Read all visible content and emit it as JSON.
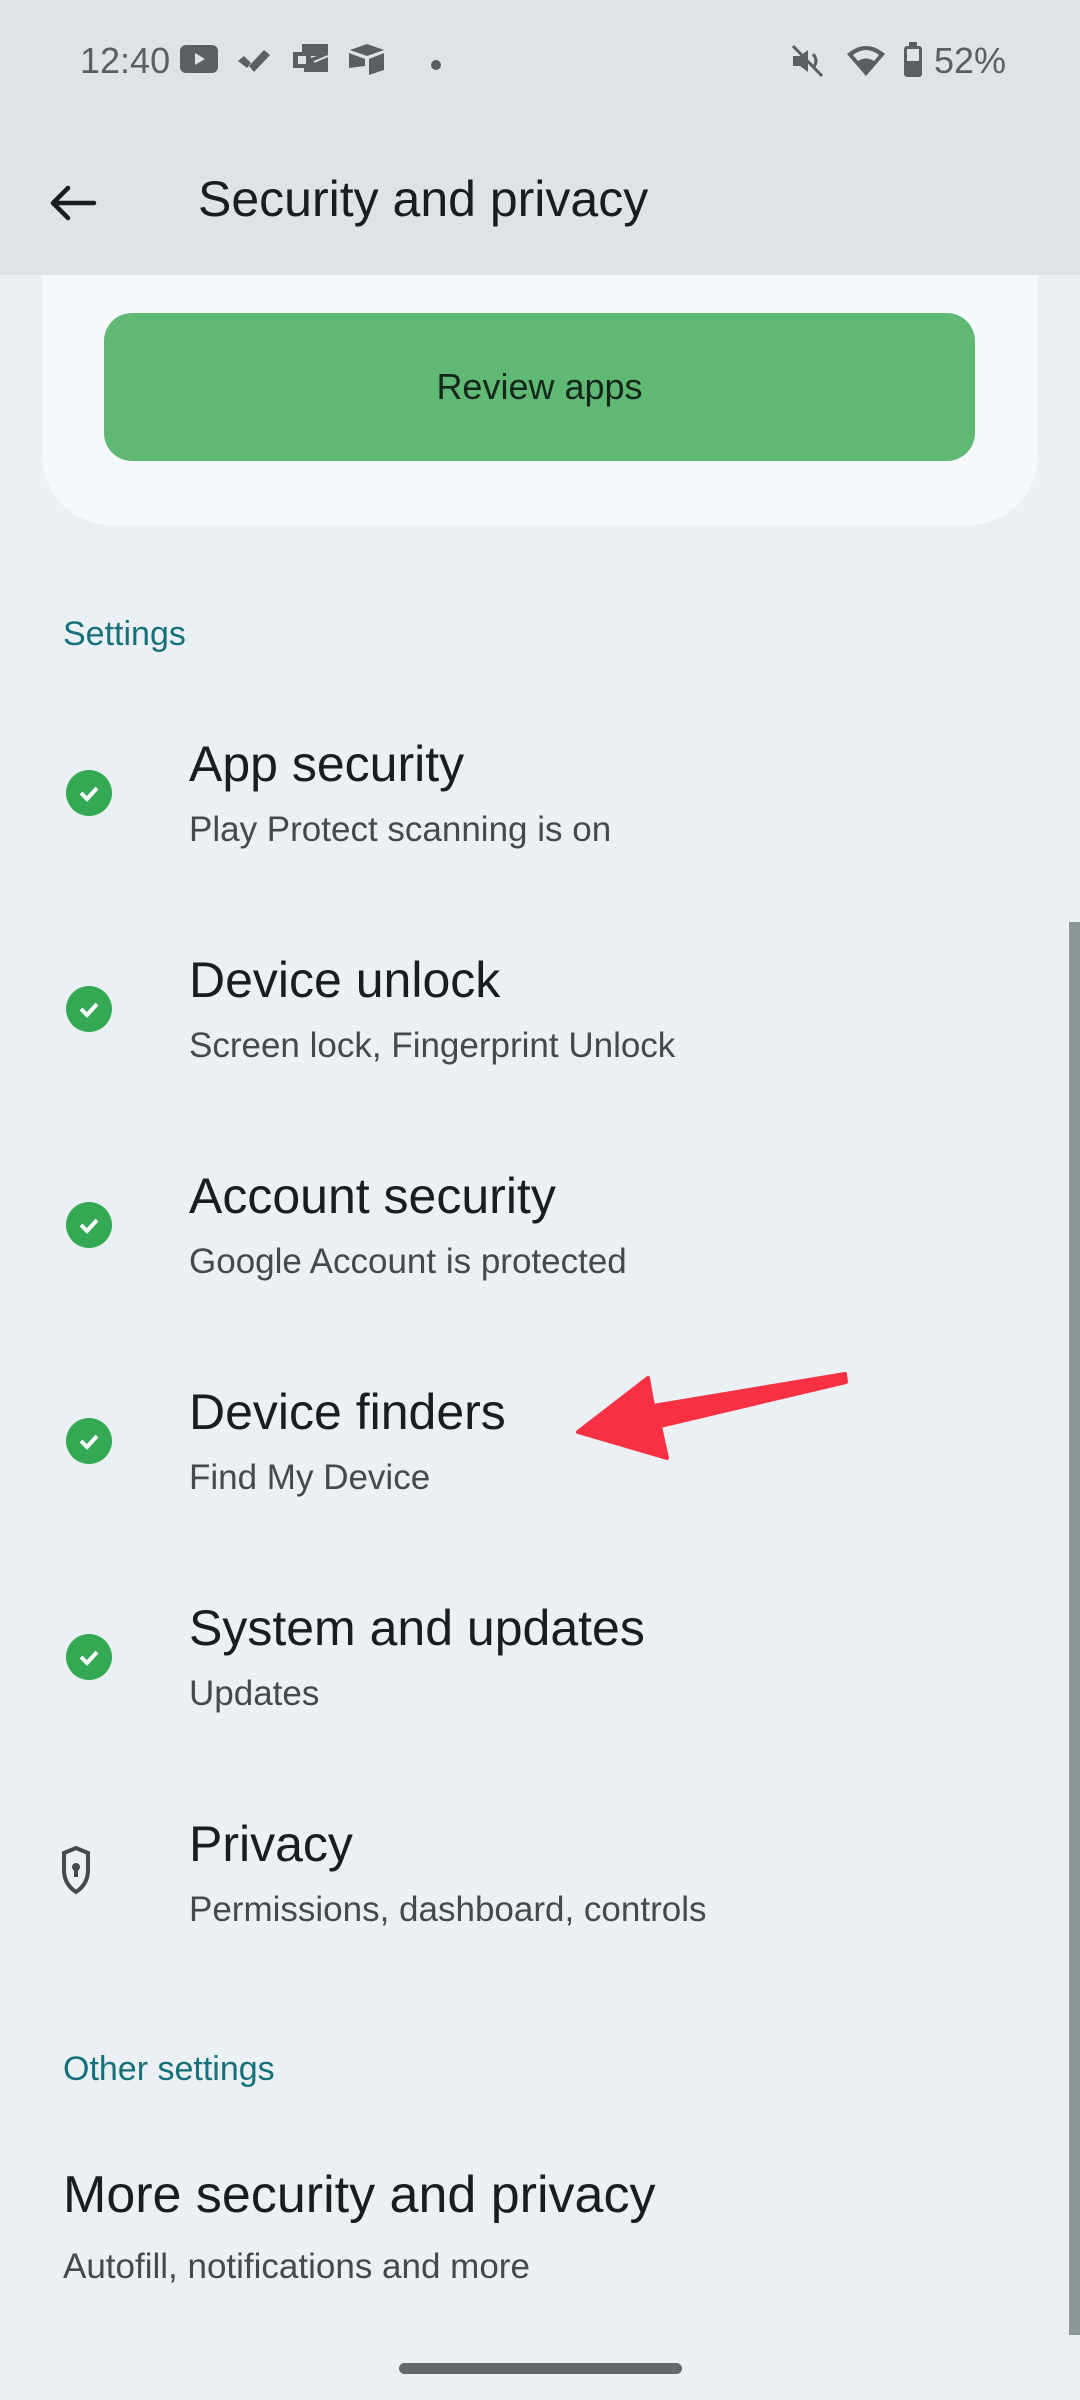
{
  "status_bar": {
    "time": "12:40",
    "notification_icons": [
      "youtube-icon",
      "tasks-check-icon",
      "outlook-icon",
      "box-icon",
      "more-dot-icon"
    ],
    "system_icons": [
      "vibrate-off-icon",
      "wifi-icon",
      "battery-icon"
    ],
    "battery_percent": "52%"
  },
  "app_bar": {
    "back_icon": "arrow-left-icon",
    "title": "Security and privacy"
  },
  "review_card": {
    "button_label": "Review apps",
    "button_color": "#5fb975"
  },
  "sections": {
    "settings_label": "Settings",
    "other_label": "Other settings"
  },
  "items": [
    {
      "title": "App security",
      "subtitle": "Play Protect scanning is on",
      "icon": "check-circle-icon"
    },
    {
      "title": "Device unlock",
      "subtitle": "Screen lock, Fingerprint Unlock",
      "icon": "check-circle-icon"
    },
    {
      "title": "Account security",
      "subtitle": "Google Account is protected",
      "icon": "check-circle-icon"
    },
    {
      "title": "Device finders",
      "subtitle": "Find My Device",
      "icon": "check-circle-icon"
    },
    {
      "title": "System and updates",
      "subtitle": "Updates",
      "icon": "check-circle-icon"
    },
    {
      "title": "Privacy",
      "subtitle": "Permissions, dashboard, controls",
      "icon": "shield-keyhole-icon"
    }
  ],
  "other_items": [
    {
      "title": "More security and privacy",
      "subtitle": "Autofill, notifications and more"
    }
  ],
  "annotation": {
    "type": "red-arrow",
    "points_to": "Device finders",
    "color": "#f73143"
  },
  "colors": {
    "accent": "#16707a",
    "check": "#34a853",
    "background": "#eaf0f3",
    "app_bar": "#dfe3e6"
  }
}
